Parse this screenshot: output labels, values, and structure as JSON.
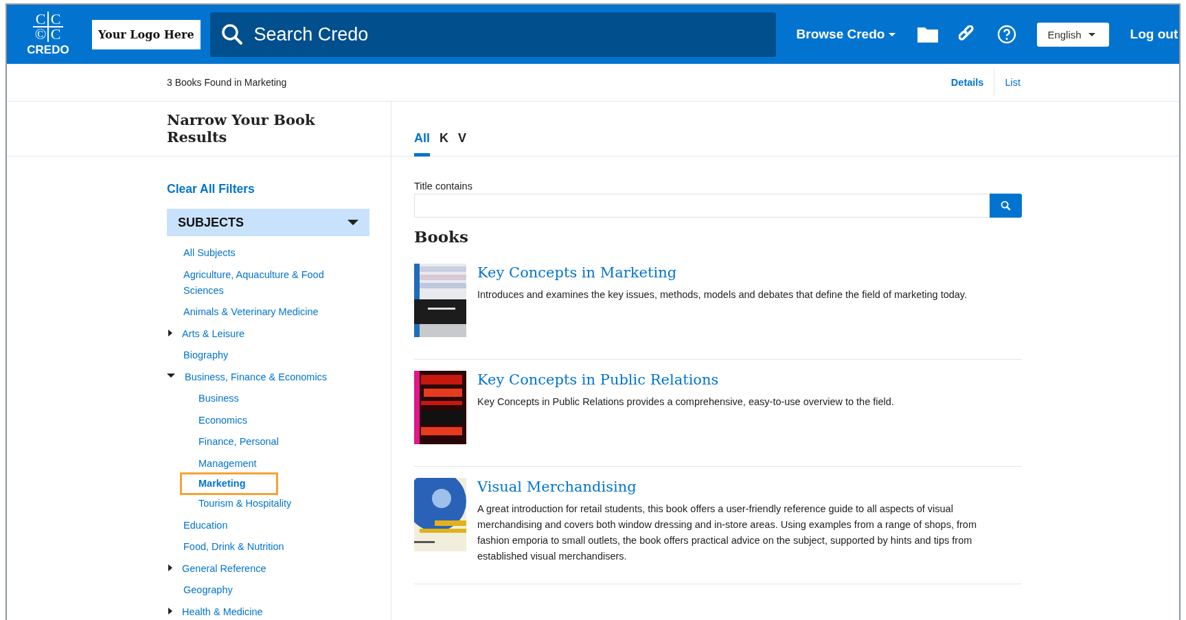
{
  "header": {
    "logo": {
      "marks": [
        "C",
        "C",
        "©",
        "C"
      ],
      "wordmark": "CREDO"
    },
    "custom_logo": "Your Logo Here",
    "search": {
      "placeholder": "Search Credo"
    },
    "browse": "Browse Credo",
    "language": "English",
    "logout": "Log out"
  },
  "subbar": {
    "results": "3 Books Found in Marketing",
    "views": [
      {
        "label": "Details",
        "selected": true
      },
      {
        "label": "List",
        "selected": false
      }
    ]
  },
  "sidebar": {
    "heading": "Narrow Your Book Results",
    "clear": "Clear All Filters",
    "section": {
      "title": "SUBJECTS",
      "expanded": true
    },
    "items": [
      {
        "label": "All Subjects",
        "kind": "plain",
        "selected": false
      },
      {
        "label": "Agriculture, Aquaculture & Food Sciences",
        "kind": "plain",
        "selected": false
      },
      {
        "label": "Animals & Veterinary Medicine",
        "kind": "plain",
        "selected": false
      },
      {
        "label": "Arts & Leisure",
        "kind": "toggle",
        "expanded": false,
        "selected": false
      },
      {
        "label": "Biography",
        "kind": "plain",
        "selected": false
      },
      {
        "label": "Business, Finance & Economics",
        "kind": "toggle",
        "expanded": true,
        "selected": false,
        "children": [
          {
            "label": "Business",
            "selected": false
          },
          {
            "label": "Economics",
            "selected": false
          },
          {
            "label": "Finance, Personal",
            "selected": false
          },
          {
            "label": "Management",
            "selected": false
          },
          {
            "label": "Marketing",
            "selected": true
          },
          {
            "label": "Tourism & Hospitality",
            "selected": false
          }
        ]
      },
      {
        "label": "Education",
        "kind": "plain",
        "selected": false
      },
      {
        "label": "Food, Drink & Nutrition",
        "kind": "plain",
        "selected": false
      },
      {
        "label": "General Reference",
        "kind": "toggle",
        "expanded": false,
        "selected": false
      },
      {
        "label": "Geography",
        "kind": "plain",
        "selected": false
      },
      {
        "label": "Health & Medicine",
        "kind": "toggle",
        "expanded": false,
        "selected": false
      }
    ]
  },
  "main": {
    "tabs": [
      {
        "label": "All",
        "selected": true
      },
      {
        "label": "K",
        "selected": false
      },
      {
        "label": "V",
        "selected": false
      }
    ],
    "filter": {
      "label": "Title contains"
    },
    "heading": "Books",
    "books": [
      {
        "title": "Key Concepts in Marketing",
        "description": "Introduces and examines the key issues, methods, models and debates that define the field of marketing today."
      },
      {
        "title": "Key Concepts in Public Relations",
        "description": "Key Concepts in Public Relations provides a comprehensive, easy-to-use overview to the field."
      },
      {
        "title": "Visual Merchandising",
        "description": "A great introduction for retail students, this book offers a user-friendly reference guide to all aspects of visual merchandising and covers both window dressing and in-store areas. Using examples from a range of shops, from fashion emporia to small outlets, the book offers practical advice on the subject, supported by hints and tips from established visual merchandisers."
      }
    ]
  }
}
